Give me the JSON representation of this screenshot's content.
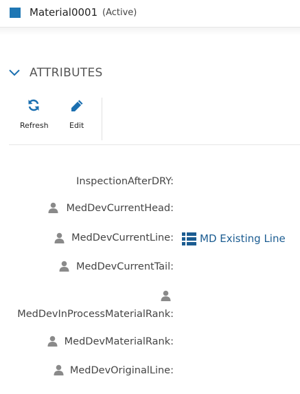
{
  "header": {
    "title": "Material0001",
    "status": "(Active)",
    "status_color": "#1f77b4"
  },
  "section": {
    "title": "ATTRIBUTES",
    "toggle_icon": "chevron-down-icon"
  },
  "toolbar": {
    "refresh": {
      "label": "Refresh",
      "icon": "refresh-icon"
    },
    "edit": {
      "label": "Edit",
      "icon": "pencil-icon"
    }
  },
  "attributes": [
    {
      "label": "InspectionAfterDRY:",
      "icon": null,
      "value": ""
    },
    {
      "label": "MedDevCurrentHead:",
      "icon": "user-icon",
      "value": ""
    },
    {
      "label": "MedDevCurrentLine:",
      "icon": "user-icon",
      "value": "MD Existing Line",
      "value_icon": "list-icon"
    },
    {
      "label": "MedDevCurrentTail:",
      "icon": "user-icon",
      "value": ""
    },
    {
      "label": "MedDevInProcessMaterialRank:",
      "icon": "user-icon",
      "value": ""
    },
    {
      "label": "MedDevMaterialRank:",
      "icon": "user-icon",
      "value": ""
    },
    {
      "label": "MedDevOriginalLine:",
      "icon": "user-icon",
      "value": ""
    }
  ],
  "colors": {
    "accent": "#1b5c91",
    "icon_gray": "#8a8a8a"
  }
}
